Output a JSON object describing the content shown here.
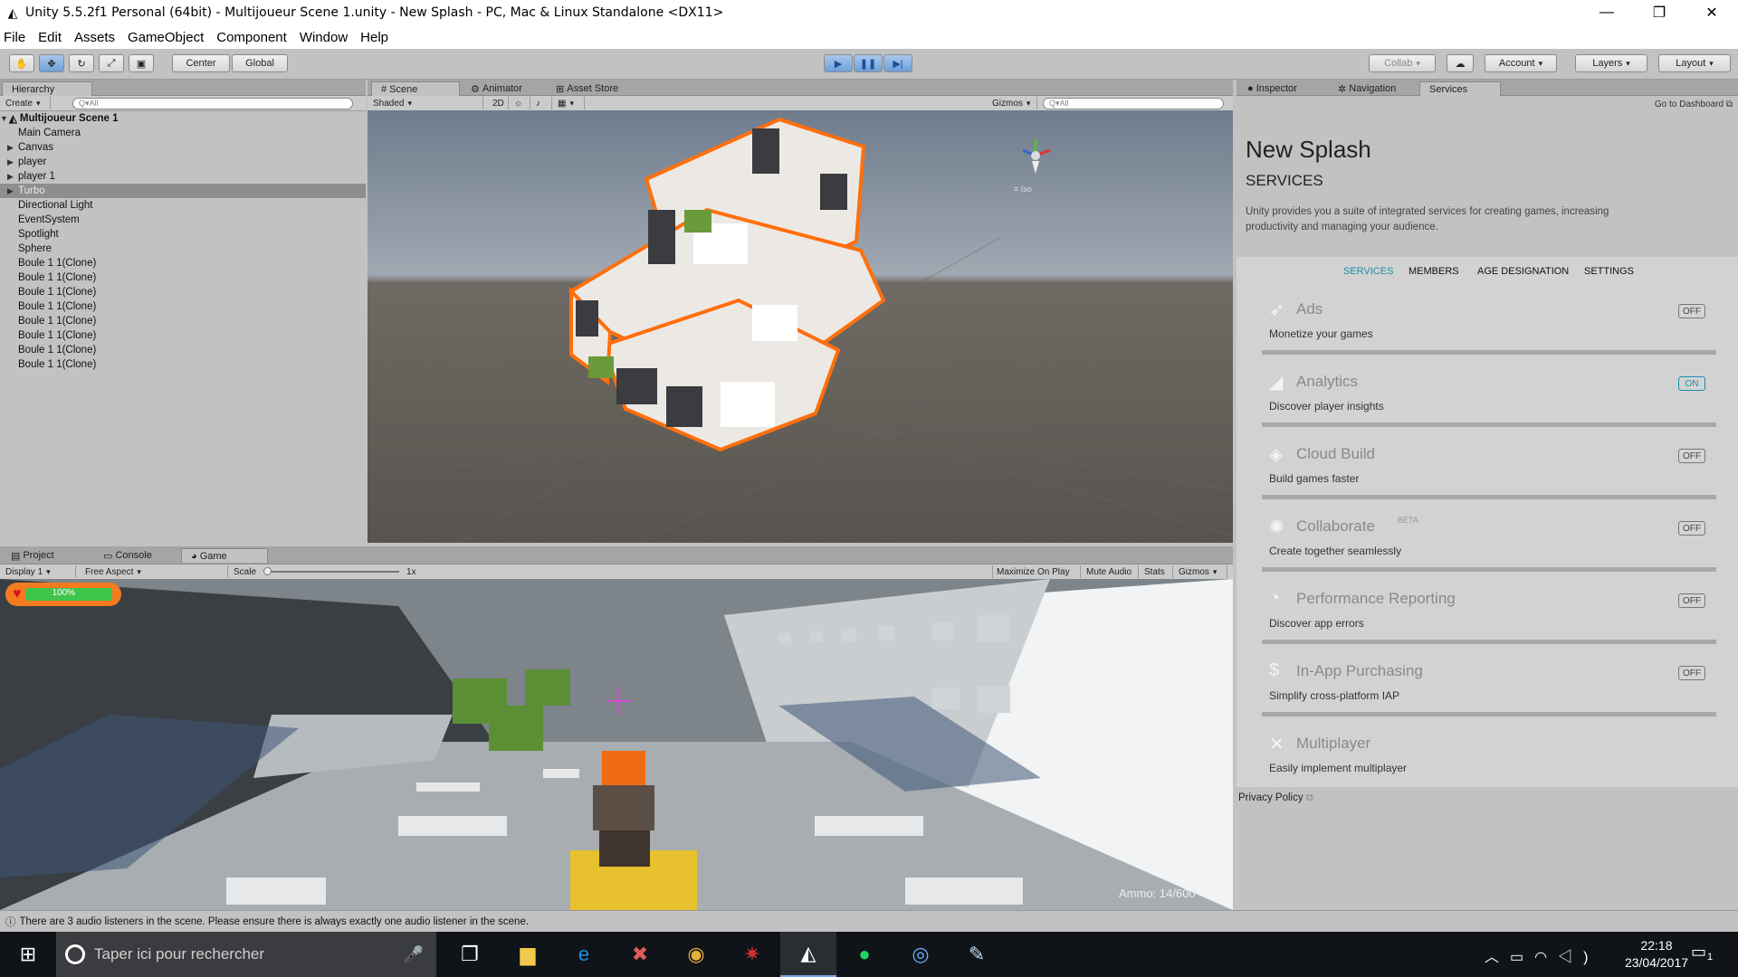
{
  "window": {
    "title": "Unity 5.5.2f1 Personal (64bit) - Multijoueur Scene 1.unity - New Splash - PC, Mac & Linux Standalone <DX11>",
    "minimize": "—",
    "restore": "❐",
    "close": "✕"
  },
  "menu": [
    "File",
    "Edit",
    "Assets",
    "GameObject",
    "Component",
    "Window",
    "Help"
  ],
  "toolbar": {
    "center": "Center",
    "global": "Global",
    "collab": "Collab",
    "account": "Account",
    "layers": "Layers",
    "layout": "Layout"
  },
  "hierarchy": {
    "tab": "Hierarchy",
    "create": "Create",
    "search_placeholder": "Q▾All",
    "scene": "Multijoueur Scene 1",
    "items": [
      {
        "label": "Main Camera"
      },
      {
        "label": "Canvas"
      },
      {
        "label": "player"
      },
      {
        "label": "player 1"
      },
      {
        "label": "Turbo"
      },
      {
        "label": "Directional Light"
      },
      {
        "label": "EventSystem"
      },
      {
        "label": "Spotlight"
      },
      {
        "label": "Sphere"
      },
      {
        "label": "Boule 1 1(Clone)"
      },
      {
        "label": "Boule 1 1(Clone)"
      },
      {
        "label": "Boule 1 1(Clone)"
      },
      {
        "label": "Boule 1 1(Clone)"
      },
      {
        "label": "Boule 1 1(Clone)"
      },
      {
        "label": "Boule 1 1(Clone)"
      },
      {
        "label": "Boule 1 1(Clone)"
      },
      {
        "label": "Boule 1 1(Clone)"
      }
    ]
  },
  "scene": {
    "tabs": [
      "Scene",
      "Animator",
      "Asset Store"
    ],
    "shading": "Shaded",
    "mode2d": "2D",
    "gizmos": "Gizmos",
    "search_placeholder": "Q▾All",
    "persp": "≡ Iso"
  },
  "bottom_tabs": [
    "Project",
    "Console",
    "Game"
  ],
  "game": {
    "display": "Display 1",
    "aspect": "Free Aspect",
    "scale_label": "Scale",
    "scale_value": "1x",
    "maximize": "Maximize On Play",
    "mute": "Mute Audio",
    "stats": "Stats",
    "gizmos": "Gizmos",
    "health": "100%",
    "health_fraction": 1.0,
    "ammo": "Ammo: 14/600"
  },
  "inspector_tabs": [
    "Inspector",
    "Navigation",
    "Services"
  ],
  "services": {
    "dashboard": "Go to Dashboard",
    "project": "New Splash",
    "heading": "SERVICES",
    "intro": "Unity provides you a suite of integrated services for creating games, increasing productivity and managing your audience.",
    "subtabs": [
      "SERVICES",
      "MEMBERS",
      "AGE DESIGNATION",
      "SETTINGS"
    ],
    "beta": "BETA",
    "items": [
      {
        "name": "Ads",
        "desc": "Monetize your games",
        "toggle": "OFF",
        "icon": "ads-icon"
      },
      {
        "name": "Analytics",
        "desc": "Discover player insights",
        "toggle": "ON",
        "icon": "analytics-icon"
      },
      {
        "name": "Cloud Build",
        "desc": "Build games faster",
        "toggle": "OFF",
        "icon": "cloud-build-icon"
      },
      {
        "name": "Collaborate",
        "desc": "Create together seamlessly",
        "toggle": "OFF",
        "icon": "collaborate-icon"
      },
      {
        "name": "Performance Reporting",
        "desc": "Discover app errors",
        "toggle": "OFF",
        "icon": "performance-icon"
      },
      {
        "name": "In-App Purchasing",
        "desc": "Simplify cross-platform IAP",
        "toggle": "OFF",
        "icon": "dollar-icon"
      },
      {
        "name": "Multiplayer",
        "desc": "Easily implement multiplayer",
        "toggle": "",
        "icon": "multiplayer-icon"
      }
    ],
    "privacy": "Privacy Policy"
  },
  "status": {
    "message": "There are 3 audio listeners in the scene. Please ensure there is always exactly one audio listener in the scene."
  },
  "taskbar": {
    "search_placeholder": "Taper ici pour rechercher",
    "time": "22:18",
    "date": "23/04/2017",
    "notifications": "1"
  }
}
